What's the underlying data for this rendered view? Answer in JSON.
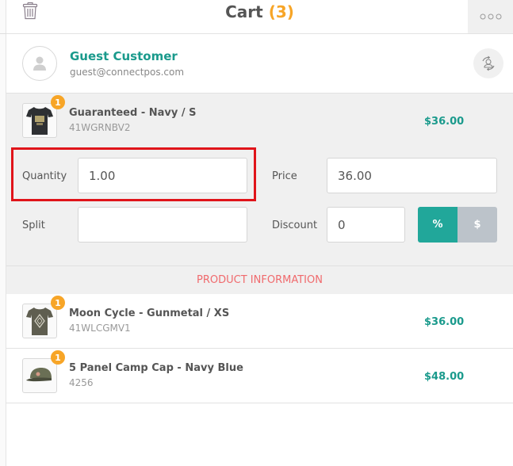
{
  "header": {
    "title": "Cart",
    "count": "(3)",
    "icons": {
      "delete": "trash-icon",
      "more": "more-options-icon"
    }
  },
  "customer": {
    "name": "Guest Customer",
    "email": "guest@connectpos.com",
    "icons": {
      "avatar": "user-icon",
      "switch": "switch-customer-icon"
    }
  },
  "expanded_item": {
    "name": "Guaranteed - Navy / S",
    "sku": "41WGRNBV2",
    "price": "$36.00",
    "qty_badge": "1",
    "fields": {
      "quantity_label": "Quantity",
      "quantity_value": "1.00",
      "price_label": "Price",
      "price_value": "36.00",
      "split_label": "Split",
      "split_value": "",
      "discount_label": "Discount",
      "discount_value": "0"
    },
    "discount_type": {
      "options": [
        "%",
        "$"
      ],
      "selected": "%"
    }
  },
  "section_title": "PRODUCT INFORMATION",
  "items": [
    {
      "name": "Moon Cycle - Gunmetal / XS",
      "sku": "41WLCGMV1",
      "price": "$36.00",
      "qty_badge": "1"
    },
    {
      "name": "5 Panel Camp Cap - Navy Blue",
      "sku": "4256",
      "price": "$48.00",
      "qty_badge": "1"
    }
  ],
  "colors": {
    "accent": "#1a9a8c",
    "badge": "#f7a527",
    "section_title": "#f06a6d",
    "highlight": "#e0141a",
    "toggle_active": "#21a79a",
    "toggle_inactive": "#bcc3ca"
  }
}
